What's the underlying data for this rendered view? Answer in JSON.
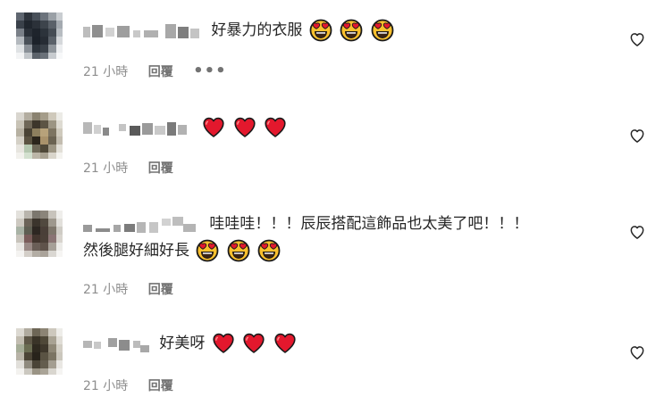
{
  "comments": [
    {
      "text": "好暴力的衣服",
      "text2": "",
      "emojis": [
        "heart-eyes",
        "heart-eyes",
        "heart-eyes"
      ],
      "time": "21 小時",
      "reply": "回覆",
      "more": "•••"
    },
    {
      "text": "",
      "text2": "",
      "emojis": [
        "red-heart",
        "red-heart",
        "red-heart"
      ],
      "time": "21 小時",
      "reply": "回覆",
      "more": ""
    },
    {
      "text": "哇哇哇！！！辰辰搭配這飾品也太美了吧！！！",
      "text2": "然後腿好細好長",
      "emojis": [
        "heart-eyes",
        "heart-eyes",
        "heart-eyes"
      ],
      "time": "21 小時",
      "reply": "回覆",
      "more": ""
    },
    {
      "text": "好美呀",
      "text2": "",
      "emojis": [
        "red-heart",
        "red-heart",
        "red-heart"
      ],
      "time": "21 小時",
      "reply": "回覆",
      "more": ""
    }
  ],
  "colors": {
    "text": "#262626",
    "meta": "#8e8e8e",
    "heart_red": "#e3182d",
    "emoji_face": "#fbc02d"
  }
}
